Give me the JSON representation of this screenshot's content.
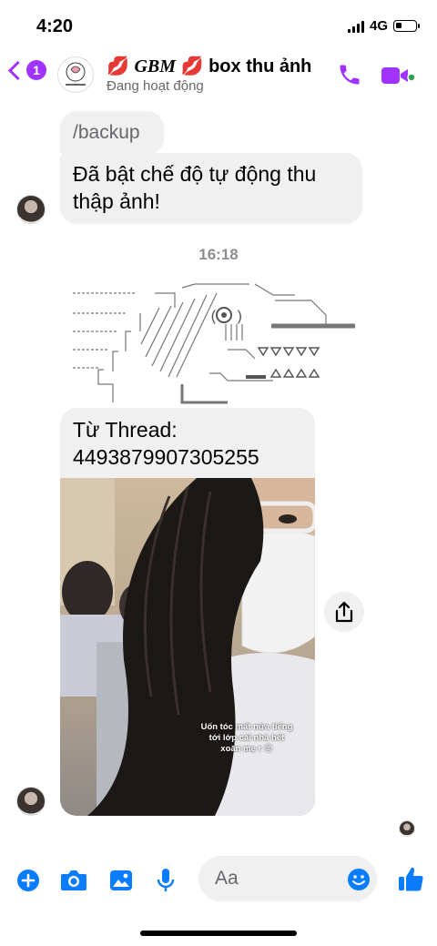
{
  "status": {
    "time": "4:20",
    "network": "4G"
  },
  "header": {
    "unread_count": "1",
    "title_logo": "GBM",
    "title_text": "box thu ảnh",
    "status": "Đang hoạt động"
  },
  "messages": {
    "backup": "/backup",
    "collect": "Đã bật chế độ tự động thu thập ảnh!",
    "timestamp": "16:18",
    "thread_label": "Từ Thread:",
    "thread_id": "4493879907305255",
    "photo_caption": "Uốn tóc mất nửa tiếng tới lớp cái nhà hết xoăn mẹ r 😊"
  },
  "composer": {
    "placeholder": "Aa"
  },
  "colors": {
    "accent": "#a033ff",
    "messenger_blue": "#0a7cff",
    "online": "#31a24c",
    "bubble": "#f0f0f0"
  },
  "icons": [
    "back-chevron-icon",
    "phone-icon",
    "video-camera-icon",
    "share-icon",
    "plus-icon",
    "camera-icon",
    "gallery-icon",
    "microphone-icon",
    "emoji-icon",
    "thumbs-up-icon"
  ]
}
